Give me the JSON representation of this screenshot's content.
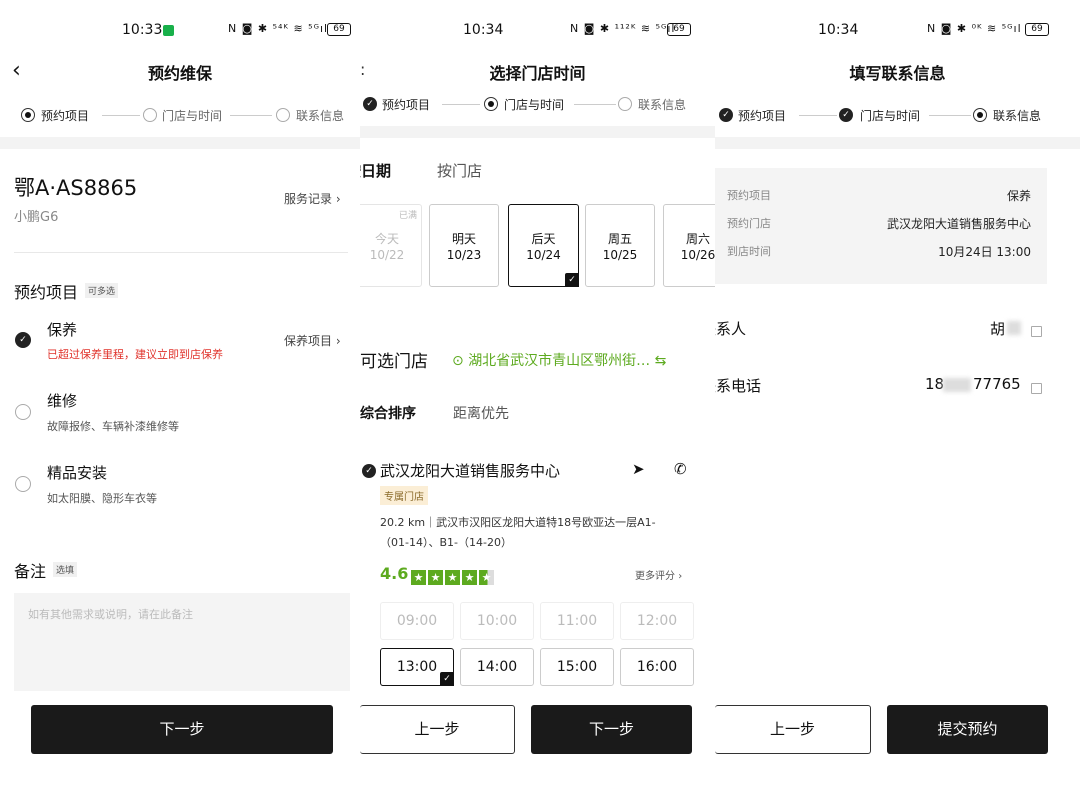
{
  "screen1": {
    "time": "10:33",
    "status_icons": "N ◙ ✱ ⁵⁴ᴷ ≋ ⁵ᴳıl",
    "battery": "69",
    "title": "预约维保",
    "steps": [
      "预约项目",
      "门店与时间",
      "联系信息"
    ],
    "plate": "鄂A·AS8865",
    "model": "小鹏G6",
    "service_record": "服务记录",
    "section_title": "预约项目",
    "multi_tag": "可多选",
    "items": [
      {
        "name": "保养",
        "desc": "已超过保养里程，建议立即到店保养",
        "link": "保养项目",
        "checked": true
      },
      {
        "name": "维修",
        "desc": "故障报修、车辆补漆维修等",
        "checked": false
      },
      {
        "name": "精品安装",
        "desc": "如太阳膜、隐形车衣等",
        "checked": false
      }
    ],
    "remark_title": "备注",
    "remark_tag": "选填",
    "remark_placeholder": "如有其他需求或说明，请在此备注",
    "next_button": "下一步"
  },
  "screen2": {
    "time": "10:34",
    "status_icons": "N ◙ ✱ ¹¹²ᴷ ≋ ⁵ᴳıl",
    "battery": "69",
    "title": "选择门店时间",
    "steps": [
      "预约项目",
      "门店与时间",
      "联系信息"
    ],
    "tabs": [
      "按日期",
      "按门店"
    ],
    "dates": [
      {
        "label": "今天",
        "date": "10/22",
        "tag": "已满",
        "state": "disabled"
      },
      {
        "label": "明天",
        "date": "10/23",
        "tag": "",
        "state": "normal"
      },
      {
        "label": "后天",
        "date": "10/24",
        "tag": "",
        "state": "selected"
      },
      {
        "label": "周五",
        "date": "10/25",
        "tag": "",
        "state": "normal"
      },
      {
        "label": "周六",
        "date": "10/26",
        "tag": "",
        "state": "normal"
      }
    ],
    "store_section": "可选门店",
    "location": "湖北省武汉市青山区鄂州街…",
    "sort_tabs": [
      "综合排序",
      "距离优先"
    ],
    "store": {
      "name": "武汉龙阳大道销售服务中心",
      "badge": "专属门店",
      "address_line1": "20.2 km｜武汉市汉阳区龙阳大道特18号欧亚达一层A1-",
      "address_line2": "（01-14）、B1-（14-20）",
      "rating": "4.6",
      "more_reviews": "更多评分"
    },
    "slots": [
      {
        "time": "09:00",
        "state": "disabled"
      },
      {
        "time": "10:00",
        "state": "disabled"
      },
      {
        "time": "11:00",
        "state": "disabled"
      },
      {
        "time": "12:00",
        "state": "disabled"
      },
      {
        "time": "13:00",
        "state": "selected"
      },
      {
        "time": "14:00",
        "state": "normal"
      },
      {
        "time": "15:00",
        "state": "normal"
      },
      {
        "time": "16:00",
        "state": "normal"
      }
    ],
    "prev_button": "上一步",
    "next_button": "下一步"
  },
  "screen3": {
    "time": "10:34",
    "status_icons": "N ◙ ✱ ⁰ᴷ ≋ ⁵ᴳıl",
    "battery": "69",
    "title": "填写联系信息",
    "steps": [
      "预约项目",
      "门店与时间",
      "联系信息"
    ],
    "summary": [
      {
        "label": "预约项目",
        "value": "保养"
      },
      {
        "label": "预约门店",
        "value": "武汉龙阳大道销售服务中心"
      },
      {
        "label": "到店时间",
        "value": "10月24日 13:00"
      }
    ],
    "contact_label": "联系人",
    "contact_value": "胡",
    "phone_label": "联系电话",
    "phone_prefix": "18",
    "phone_suffix": "77765",
    "prev_button": "上一步",
    "submit_button": "提交预约"
  },
  "colors": {
    "accent_green": "#5daa1f",
    "warning_red": "#e0322b",
    "dark": "#1a1a1a"
  }
}
